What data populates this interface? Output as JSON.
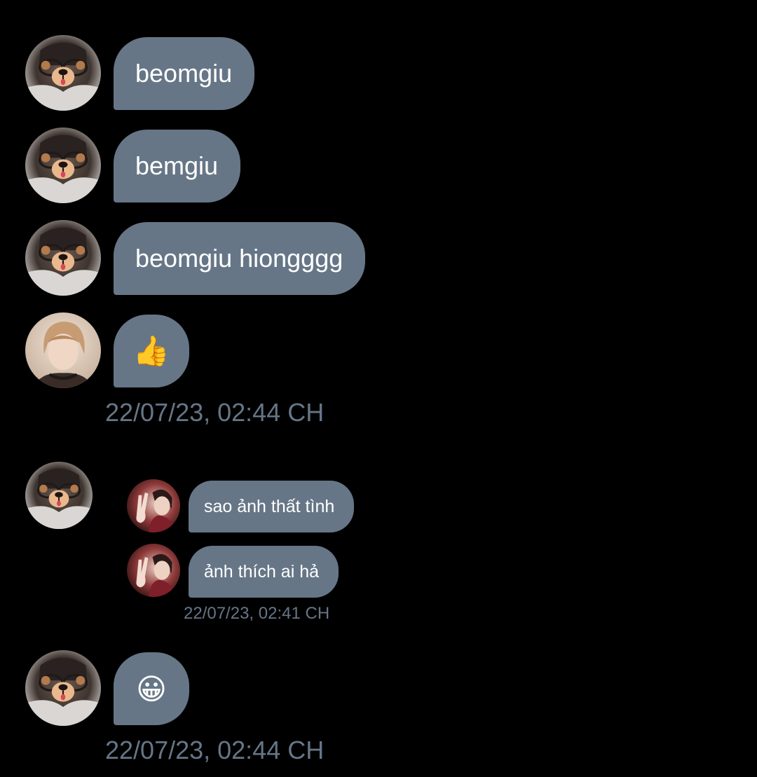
{
  "colors": {
    "background": "#000000",
    "bubble": "#667687",
    "bubble_text": "#ffffff",
    "timestamp": "#667687"
  },
  "messages": [
    {
      "sender_avatar": "bear-filter-avatar",
      "text": "beomgiu"
    },
    {
      "sender_avatar": "bear-filter-avatar",
      "text": "bemgiu"
    },
    {
      "sender_avatar": "bear-filter-avatar",
      "text": "beomgiu hiongggg"
    },
    {
      "sender_avatar": "portrait-avatar",
      "emoji": "👍",
      "emoji_icon": "thumbs-up-icon"
    }
  ],
  "timestamp_1": "22/07/23, 02:44 CH",
  "forwarded": {
    "sender_avatar": "bear-filter-avatar",
    "quoted_messages": [
      {
        "avatar": "peace-sign-avatar",
        "text": "sao ảnh thất tình"
      },
      {
        "avatar": "peace-sign-avatar",
        "text": "ảnh thích ai hả"
      }
    ],
    "quoted_timestamp": "22/07/23, 02:41 CH"
  },
  "reply": {
    "sender_avatar": "bear-filter-avatar",
    "emoji": "😀",
    "emoji_icon": "grinning-face-icon"
  },
  "timestamp_2": "22/07/23, 02:44 CH"
}
